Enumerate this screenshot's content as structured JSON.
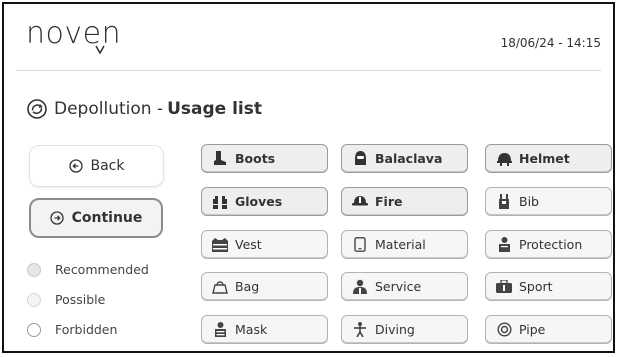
{
  "header": {
    "logo_text": "noven",
    "datetime": "18/06/24 - 14:15"
  },
  "page": {
    "title_plain": "Depollution - ",
    "title_bold": "Usage list"
  },
  "buttons": {
    "back_label": "Back",
    "continue_label": "Continue"
  },
  "legend": [
    {
      "label": "Recommended",
      "color": "#e6e6e6",
      "border": "#c9c9c9"
    },
    {
      "label": "Possible",
      "color": "#f4f4f4",
      "border": "#d6d6d6"
    },
    {
      "label": "Forbidden",
      "color": "#ffffff",
      "border": "#9a9a9a"
    }
  ],
  "usages": [
    {
      "label": "Boots",
      "icon": "boot-icon",
      "state": "rec"
    },
    {
      "label": "Balaclava",
      "icon": "balaclava-icon",
      "state": "rec"
    },
    {
      "label": "Helmet",
      "icon": "helmet-icon",
      "state": "rec"
    },
    {
      "label": "Gloves",
      "icon": "gloves-icon",
      "state": "rec"
    },
    {
      "label": "Fire",
      "icon": "fire-icon",
      "state": "rec"
    },
    {
      "label": "Bib",
      "icon": "bib-icon",
      "state": "pos"
    },
    {
      "label": "Vest",
      "icon": "vest-icon",
      "state": "pos"
    },
    {
      "label": "Material",
      "icon": "material-icon",
      "state": "pos"
    },
    {
      "label": "Protection",
      "icon": "protection-icon",
      "state": "pos"
    },
    {
      "label": "Bag",
      "icon": "bag-icon",
      "state": "pos"
    },
    {
      "label": "Service",
      "icon": "service-icon",
      "state": "pos"
    },
    {
      "label": "Sport",
      "icon": "sport-icon",
      "state": "pos"
    },
    {
      "label": "Mask",
      "icon": "mask-icon",
      "state": "pos"
    },
    {
      "label": "Diving",
      "icon": "diving-icon",
      "state": "pos"
    },
    {
      "label": "Pipe",
      "icon": "pipe-icon",
      "state": "pos"
    }
  ]
}
